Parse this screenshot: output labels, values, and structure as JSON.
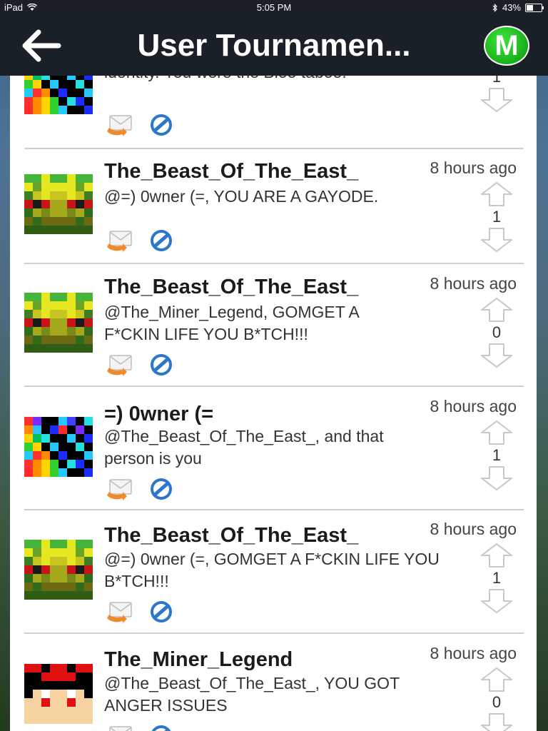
{
  "status_bar": {
    "device": "iPad",
    "time": "5:05 PM",
    "battery_text": "43%",
    "battery_level": 0.43
  },
  "navbar": {
    "title": "User Tournamen...",
    "logo_letter": "M",
    "back_icon": "arrow-left-icon"
  },
  "colors": {
    "navbar_bg": "#1a2028",
    "logo_green": "#19b01a",
    "reply_orange": "#f08a2a",
    "block_blue": "#2c77c9",
    "vote_arrow_outline": "#c7c7c7"
  },
  "comments": [
    {
      "author": "",
      "time": "",
      "text": "identity. You were the Bloo taboo.",
      "votes": "1",
      "avatar": "rainbow"
    },
    {
      "author": "The_Beast_Of_The_East_",
      "time": "8 hours ago",
      "text": "@=) 0wner (=, YOU ARE A GAYODE.",
      "votes": "1",
      "avatar": "green-yellow"
    },
    {
      "author": "The_Beast_Of_The_East_",
      "time": "8 hours ago",
      "text": "@The_Miner_Legend, GOMGET A F*CKIN LIFE YOU B*TCH!!!",
      "votes": "0",
      "avatar": "green-yellow"
    },
    {
      "author": "=) 0wner (=",
      "time": "8 hours ago",
      "text": "@The_Beast_Of_The_East_, and that person is you",
      "votes": "1",
      "avatar": "rainbow"
    },
    {
      "author": "The_Beast_Of_The_East_",
      "time": "8 hours ago",
      "text": "@=) 0wner (=, GOMGET A F*CKIN LIFE YOU B*TCH!!!",
      "votes": "1",
      "avatar": "green-yellow"
    },
    {
      "author": "The_Miner_Legend",
      "time": "8 hours ago",
      "text": "@The_Beast_Of_The_East_, YOU GOT ANGER ISSUES",
      "votes": "0",
      "avatar": "red-face"
    }
  ]
}
